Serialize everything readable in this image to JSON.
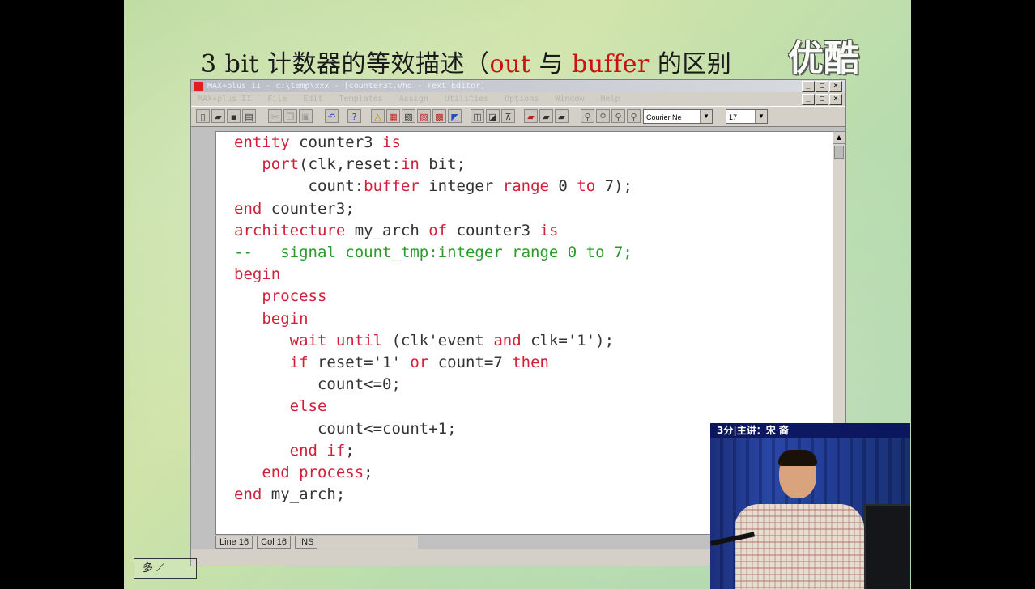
{
  "slide": {
    "title_prefix": "3 bit 计数器的等效描述（",
    "title_out": "out",
    "title_mid": " 与 ",
    "title_buffer": "buffer",
    "title_suffix": " 的区别",
    "watermark": "优酷",
    "nav_label": "多"
  },
  "window": {
    "title": "MAX+plus II - c:\\temp\\xxx - [counter3t.vhd - Text Editor]",
    "menu": [
      "MAX+plus II",
      "File",
      "Edit",
      "Templates",
      "Assign",
      "Utilities",
      "Options",
      "Window",
      "Help"
    ],
    "font_name": "Courier Ne",
    "font_size": "17"
  },
  "editor": {
    "status": {
      "line": "Line  16",
      "col": "Col  16",
      "mode": "INS"
    }
  },
  "video": {
    "caption": "3分|主讲：宋 裔"
  },
  "colors": {
    "keyword": "#d0203a",
    "comment": "#2a9a2a",
    "text": "#333333"
  }
}
